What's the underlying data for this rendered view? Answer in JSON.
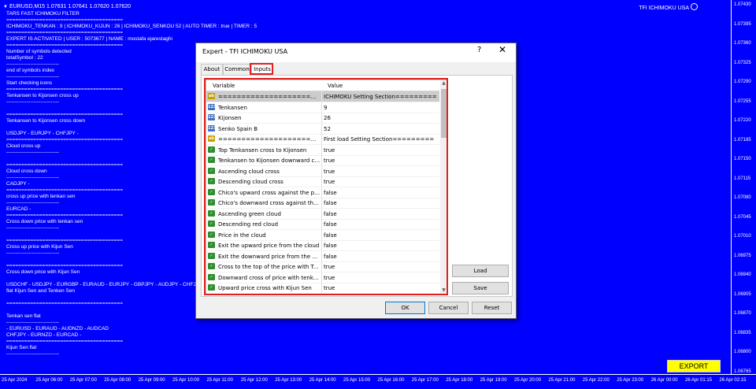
{
  "chart": {
    "symbol_line": "EURUSD,M15  1.07631 1.07641 1.07620 1.07620",
    "ea_label": "TFI ICHIMOKU USA",
    "log_lines": [
      "TARS FAST ICHIMOKU FILTER",
      "=======================================",
      "ICHIMOKU_TENKAN : 9 | ICHIMOKU_KIJUN : 26 | ICHIMOKU_SENKOU 52   | AUTO TIMER : true | TIMER : 5",
      "=======================================",
      "EXPERT IS ACTIVATED | USER : 5073677 | NAME : mostafa ejarestaghi",
      "=======================================",
      "Number of symbols detected",
      "totalSymbol : 22",
      "-------------------------------",
      "end of symbols index",
      "-------------------------------",
      "Start checking icons",
      "=======================================",
      "Tenkansen to Kijonsen cross up",
      "-------------------------------",
      "",
      "=======================================",
      "Tenkansen to Kijonsen cross down",
      "",
      "USDJPY - EURJPY - CHFJPY -",
      "=======================================",
      "Cloud cross up",
      "-------------------------------",
      "",
      "=======================================",
      "Cloud cross down",
      "-------------------------------",
      "CADJPY -",
      "=======================================",
      "cross up price with tenkan sen",
      "-------------------------------",
      "EURCAD -",
      "=======================================",
      "Cross down price with tenkan sen",
      "-------------------------------",
      "",
      "=======================================",
      "Cross up price with Kijun Sen",
      "-------------------------------",
      "",
      "=======================================",
      "Cross down price with Kijun Sen",
      "",
      "USDCHF - USDJPY - EURGBP - EURAUD - EURJPY - GBPJPY - AUDJPY - CHFJPY -",
      "flat Kijun Sen and Tenken Sen",
      "",
      "=======================================",
      "",
      "Tenkan sen flat",
      "-------------------------------",
      "- EURUSD - EURAUD - AUDNZD - AUDCAD",
      "CHFJPY - EURNZD - EURCAD -",
      "=======================================",
      "Kijun Sen flat",
      "-------------------------------"
    ],
    "y_ticks": [
      "1.07430",
      "1.07395",
      "1.07360",
      "1.07325",
      "1.07290",
      "1.07255",
      "1.07220",
      "1.07185",
      "1.07150",
      "1.07115",
      "1.07080",
      "1.07045",
      "1.07010",
      "1.06975",
      "1.06940",
      "1.06905",
      "1.06870",
      "1.06835",
      "1.06800",
      "1.06765"
    ],
    "x_ticks": [
      "25 Apr 2024",
      "25 Apr 06:00",
      "25 Apr 07:00",
      "25 Apr 08:00",
      "25 Apr 09:00",
      "25 Apr 10:00",
      "25 Apr 11:00",
      "25 Apr 12:00",
      "25 Apr 13:00",
      "25 Apr 14:00",
      "25 Apr 15:00",
      "25 Apr 16:00",
      "25 Apr 17:00",
      "25 Apr 18:00",
      "25 Apr 19:00",
      "25 Apr 20:00",
      "25 Apr 21:00",
      "25 Apr 22:00",
      "25 Apr 23:00",
      "26 Apr 00:00",
      "26 Apr 01:15",
      "26 Apr 02:15"
    ],
    "export_label": "EXPORT"
  },
  "dialog": {
    "title": "Expert - TFI ICHIMOKU USA",
    "help": "?",
    "close": "✕",
    "tabs": [
      "About",
      "Common",
      "Inputs"
    ],
    "col_variable": "Variable",
    "col_value": "Value",
    "rows": [
      {
        "icon": "ab",
        "name": "=================================",
        "value": "ICHIMOKU Setting Section========="
      },
      {
        "icon": "num",
        "name": "Tenkansen",
        "value": "9"
      },
      {
        "icon": "num",
        "name": "Kijonsen",
        "value": "26"
      },
      {
        "icon": "num",
        "name": "Senko Spain B",
        "value": "52"
      },
      {
        "icon": "ab",
        "name": "=================================",
        "value": "First load Setting Section========="
      },
      {
        "icon": "bool",
        "name": "Top Tenkansen cross to Kijonsen",
        "value": "true"
      },
      {
        "icon": "bool",
        "name": "Tenkansen to Kijonsen downward cross",
        "value": "true"
      },
      {
        "icon": "bool",
        "name": "Ascending cloud cross",
        "value": "true"
      },
      {
        "icon": "bool",
        "name": "Descending cloud cross",
        "value": "true"
      },
      {
        "icon": "bool",
        "name": "Chico's upward cross against the price",
        "value": "false"
      },
      {
        "icon": "bool",
        "name": "Chico's downward cross against the price",
        "value": "false"
      },
      {
        "icon": "bool",
        "name": "Ascending green cloud",
        "value": "false"
      },
      {
        "icon": "bool",
        "name": "Descending red cloud",
        "value": "false"
      },
      {
        "icon": "bool",
        "name": "Price in the cloud",
        "value": "false"
      },
      {
        "icon": "bool",
        "name": "Exit the upward price from the cloud",
        "value": "false"
      },
      {
        "icon": "bool",
        "name": "Exit the downward price from the cloud",
        "value": "false"
      },
      {
        "icon": "bool",
        "name": "Cross to the top of the price with Tenkansen",
        "value": "true"
      },
      {
        "icon": "bool",
        "name": "Downward cross of price with tenkan sen",
        "value": "true"
      },
      {
        "icon": "bool",
        "name": "Upward price cross with Kijun Sen",
        "value": "true"
      }
    ],
    "load_label": "Load",
    "save_label": "Save",
    "ok_label": "OK",
    "cancel_label": "Cancel",
    "reset_label": "Reset"
  },
  "colors": {
    "chart_bg": "#0000ff",
    "highlight": "#e02020",
    "export_bg": "#ffff00"
  }
}
